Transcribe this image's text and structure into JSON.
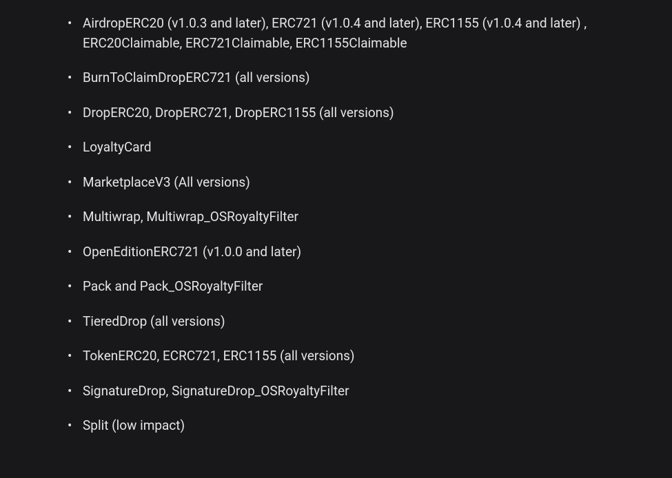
{
  "list": {
    "items": [
      "AirdropERC20 (v1.0.3 and later), ERC721 (v1.0.4 and later), ERC1155 (v1.0.4 and later) , ERC20Claimable, ERC721Claimable, ERC1155Claimable",
      "BurnToClaimDropERC721 (all versions)",
      "DropERC20, DropERC721, DropERC1155 (all versions)",
      "LoyaltyCard",
      "MarketplaceV3 (All versions)",
      "Multiwrap, Multiwrap_OSRoyaltyFilter",
      "OpenEditionERC721 (v1.0.0 and later)",
      "Pack and Pack_OSRoyaltyFilter",
      "TieredDrop (all versions)",
      "TokenERC20, ECRC721, ERC1155 (all versions)",
      "SignatureDrop, SignatureDrop_OSRoyaltyFilter",
      "Split (low impact)"
    ]
  }
}
